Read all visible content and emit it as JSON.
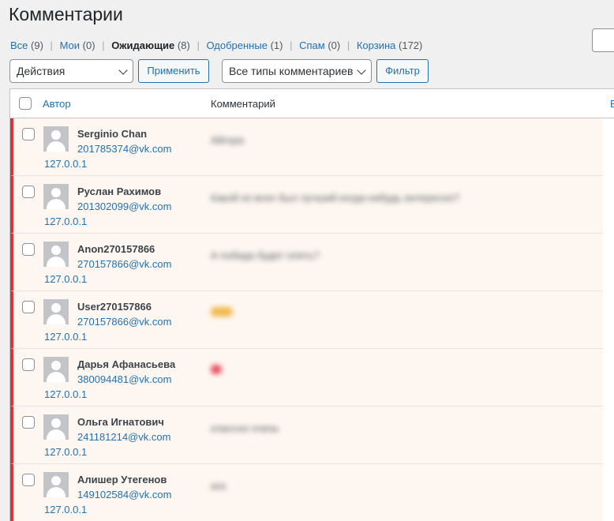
{
  "page": {
    "title": "Комментарии"
  },
  "filters": [
    {
      "label": "Все",
      "count": "(9)"
    },
    {
      "label": "Мои",
      "count": "(0)"
    },
    {
      "label": "Ожидающие",
      "count": "(8)"
    },
    {
      "label": "Одобренные",
      "count": "(1)"
    },
    {
      "label": "Спам",
      "count": "(0)"
    },
    {
      "label": "Корзина",
      "count": "(172)"
    }
  ],
  "toolbar": {
    "bulk_select": "Действия",
    "apply_label": "Применить",
    "type_select": "Все типы комментариев",
    "filter_label": "Фильтр"
  },
  "table": {
    "col_author": "Автор",
    "col_comment": "Комментарий",
    "col_response": "В",
    "rows": [
      {
        "name": "Serginio Chan",
        "email": "201785374@vk.com",
        "ip": "127.0.0.1",
        "comment": "Айгора"
      },
      {
        "name": "Руслан Рахимов",
        "email": "201302099@vk.com",
        "ip": "127.0.0.1",
        "comment": "Какой из всех был лучший когда-нибудь интересно?"
      },
      {
        "name": "Anon270157866",
        "email": "270157866@vk.com",
        "ip": "127.0.0.1",
        "comment": "А победа будет опять?"
      },
      {
        "name": "User270157866",
        "email": "270157866@vk.com",
        "ip": "127.0.0.1",
        "comment": "",
        "emoji_color": "#f0b84a"
      },
      {
        "name": "Дарья Афанасьева",
        "email": "380094481@vk.com",
        "ip": "127.0.0.1",
        "comment": "",
        "emoji_color": "#e84c5c"
      },
      {
        "name": "Ольга Игнатович",
        "email": "241181214@vk.com",
        "ip": "127.0.0.1",
        "comment": "классно очень"
      },
      {
        "name": "Алишер Утегенов",
        "email": "149102584@vk.com",
        "ip": "127.0.0.1",
        "comment": "ага"
      }
    ]
  },
  "colors": {
    "accent": "#2271b1",
    "pending_border": "#d63638",
    "pending_bg": "#fef7f1"
  }
}
